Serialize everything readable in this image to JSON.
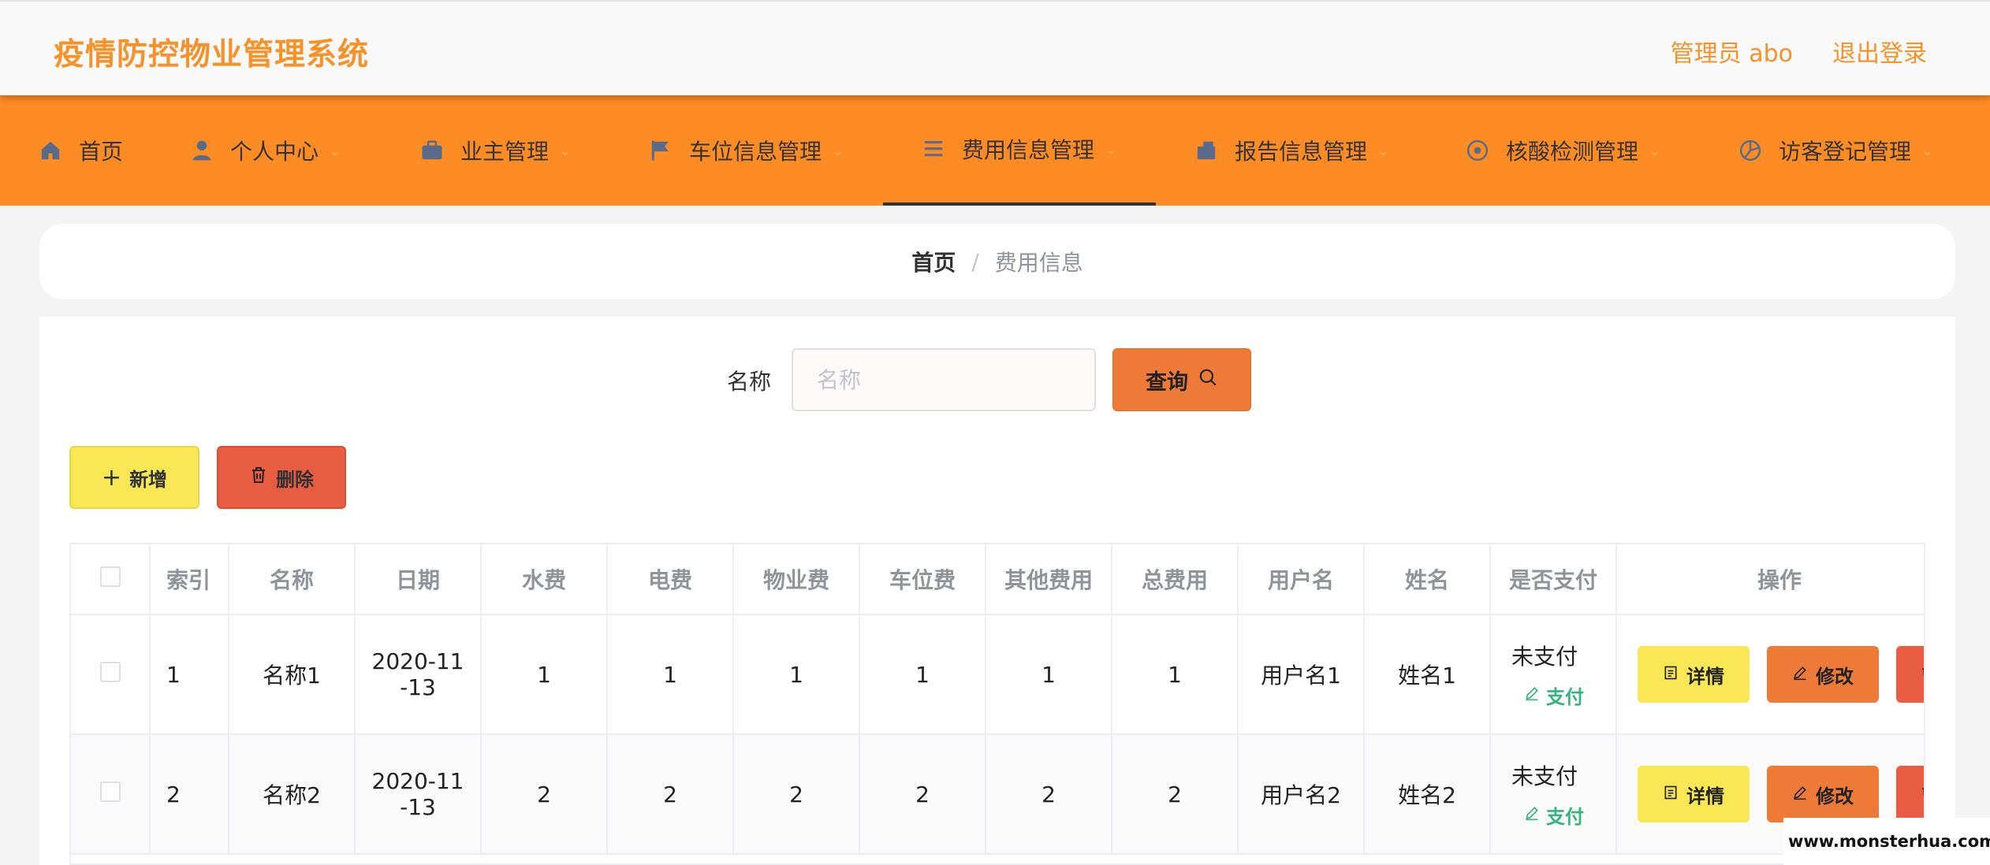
{
  "header": {
    "title": "疫情防控物业管理系统",
    "user_label": "管理员 abo",
    "logout_label": "退出登录"
  },
  "nav": {
    "items": [
      {
        "label": "首页",
        "icon": "home-icon"
      },
      {
        "label": "个人中心",
        "icon": "user-icon"
      },
      {
        "label": "业主管理",
        "icon": "briefcase-icon"
      },
      {
        "label": "车位信息管理",
        "icon": "flag-icon"
      },
      {
        "label": "费用信息管理",
        "icon": "list-icon",
        "active": true
      },
      {
        "label": "报告信息管理",
        "icon": "cart-icon"
      },
      {
        "label": "核酸检测管理",
        "icon": "circle-icon"
      },
      {
        "label": "访客登记管理",
        "icon": "aperture-icon"
      }
    ]
  },
  "breadcrumb": {
    "home": "首页",
    "separator": "/",
    "current": "费用信息"
  },
  "search": {
    "label": "名称",
    "placeholder": "名称",
    "button_label": "查询"
  },
  "actions": {
    "add_label": "新增",
    "delete_label": "删除"
  },
  "table": {
    "columns": [
      "索引",
      "名称",
      "日期",
      "水费",
      "电费",
      "物业费",
      "车位费",
      "其他费用",
      "总费用",
      "用户名",
      "姓名",
      "是否支付",
      "操作"
    ],
    "rows": [
      {
        "index": "1",
        "name": "名称1",
        "date_line1": "2020-11",
        "date_line2": "-13",
        "water": "1",
        "electric": "1",
        "property": "1",
        "parking": "1",
        "other": "1",
        "total": "1",
        "username": "用户名1",
        "realname": "姓名1",
        "paid": "未支付"
      },
      {
        "index": "2",
        "name": "名称2",
        "date_line1": "2020-11",
        "date_line2": "-13",
        "water": "2",
        "electric": "2",
        "property": "2",
        "parking": "2",
        "other": "2",
        "total": "2",
        "username": "用户名2",
        "realname": "姓名2",
        "paid": "未支付"
      }
    ],
    "pay_label": "支付",
    "detail_label": "详情",
    "edit_label": "修改"
  },
  "watermark": "www.monsterhua.com",
  "colors": {
    "accent": "#fe8c24",
    "title": "#f5922a",
    "yellow_button": "#fae755",
    "orange_button": "#ee7a38",
    "red_button": "#e85d42",
    "pay_green": "#36b37e"
  }
}
